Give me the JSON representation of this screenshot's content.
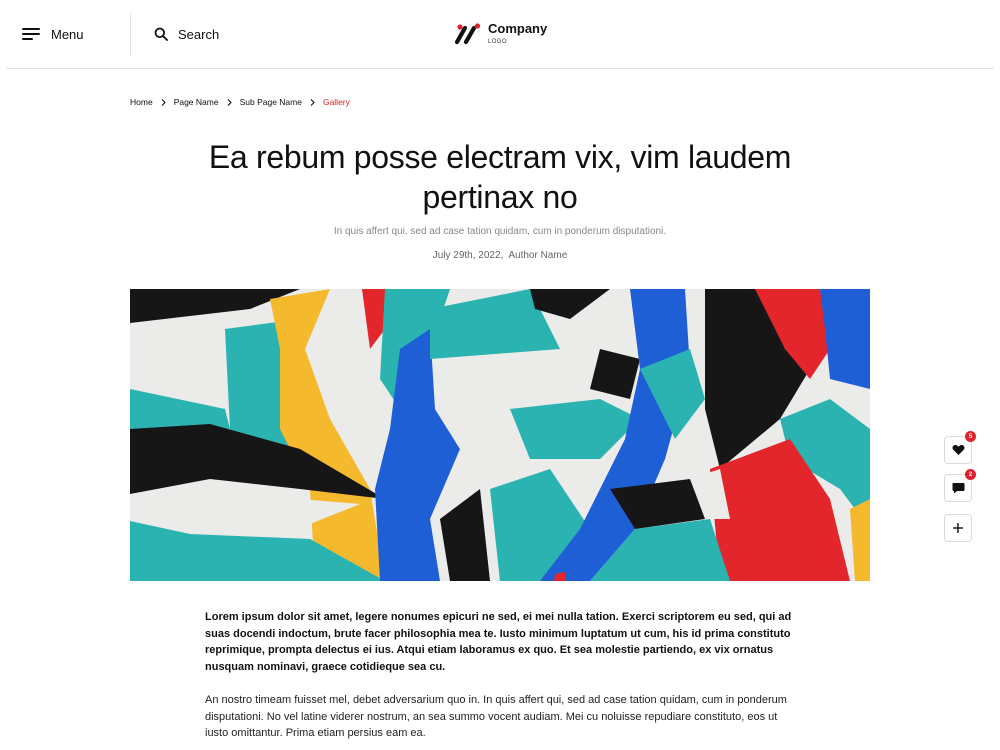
{
  "header": {
    "menu_label": "Menu",
    "search_label": "Search",
    "logo": {
      "name": "Company",
      "sub": "LOGO",
      "accent_color": "#e0202a"
    }
  },
  "breadcrumb": {
    "items": [
      "Home",
      "Page Name",
      "Sub Page Name",
      "Gallery"
    ],
    "active_color": "#e0202a"
  },
  "article": {
    "title": "Ea rebum posse electram vix, vim laudem pertinax no",
    "subtitle": "In quis affert qui, sed ad case tation quidam, cum in ponderum disputationi.",
    "date": "July 29th, 2022,",
    "author": "Author Name",
    "lead": "Lorem ipsum dolor sit amet, legere nonumes epicuri ne sed, ei mei nulla tation. Exerci scriptorem eu sed, qui ad suas docendi indoctum, brute facer philosophia mea te. Iusto minimum luptatum ut cum, his id prima constituto reprimique, prompta delectus ei ius. Atqui etiam laboramus ex quo. Et sea molestie partiendo, ex vix ornatus nusquam nominavi, graece cotidieque sea cu.",
    "paragraph": "An nostro timeam fuisset mel, debet adversarium quo in. In quis affert qui, sed ad case tation quidam, cum in ponderum disputationi. No vel latine viderer nostrum, an sea summo vocent audiam. Mei cu noluisse repudiare constituto, eos ut iusto omittantur. Prima etiam persius eam ea."
  },
  "hero_image": {
    "description_icon": "abstract-mural-image",
    "palette": [
      "#2bb3b1",
      "#f5b92e",
      "#1f5fd6",
      "#e3252c",
      "#111111",
      "#ebebea"
    ]
  },
  "actions": {
    "like_icon": "heart-icon",
    "like_count": "5",
    "comment_icon": "comment-icon",
    "comment_count": "2",
    "add_icon": "plus-icon"
  }
}
